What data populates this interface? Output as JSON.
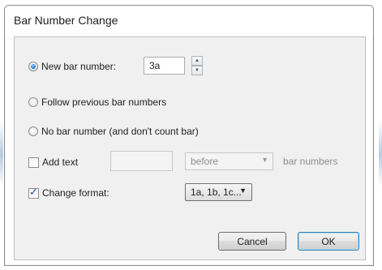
{
  "dialog": {
    "title": "Bar Number Change"
  },
  "new_bar_number": {
    "label": "New bar number:",
    "selected": true,
    "value": "3a"
  },
  "follow_previous": {
    "label": "Follow previous bar numbers",
    "selected": false
  },
  "no_bar_number": {
    "label": "No bar number (and don't count bar)",
    "selected": false
  },
  "add_text": {
    "label": "Add text",
    "checked": false,
    "text_value": "",
    "position_value": "before",
    "suffix_label": "bar numbers"
  },
  "change_format": {
    "label": "Change format:",
    "checked": true,
    "format_value": "1a, 1b, 1c..."
  },
  "buttons": {
    "cancel": "Cancel",
    "ok": "OK"
  },
  "icons": {
    "spin_up": "triangle-up",
    "spin_down": "triangle-down",
    "dropdown_arrow": "triangle-down"
  },
  "colors": {
    "client_background": "#f0f0f0",
    "disabled_text": "#8d8d8d",
    "default_button_border": "#3c7fb1"
  }
}
